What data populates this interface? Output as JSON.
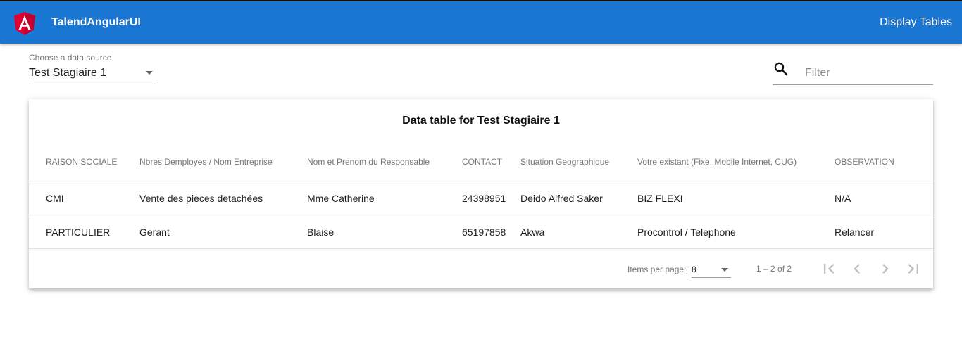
{
  "app": {
    "title": "TalendAngularUI",
    "nav_link": "Display Tables",
    "brand_color": "#1976d2"
  },
  "datasource": {
    "label": "Choose a data source",
    "value": "Test Stagiaire 1"
  },
  "filter": {
    "placeholder": "Filter",
    "value": ""
  },
  "table": {
    "title": "Data table for Test Stagiaire 1",
    "columns": [
      "RAISON SOCIALE",
      "Nbres Demployes / Nom Entreprise",
      "Nom et Prenom du Responsable",
      "CONTACT",
      "Situation Geographique",
      "Votre existant (Fixe, Mobile Internet, CUG)",
      "OBSERVATION"
    ],
    "rows": [
      [
        "CMI",
        "Vente des pieces detachées",
        "Mme Catherine",
        "24398951",
        "Deido Alfred Saker",
        "BIZ FLEXI",
        "N/A"
      ],
      [
        "PARTICULIER",
        "Gerant",
        "Blaise",
        "65197858",
        "Akwa",
        "Procontrol / Telephone",
        "Relancer"
      ]
    ]
  },
  "paginator": {
    "items_per_page_label": "Items per page:",
    "page_size": "8",
    "range_label": "1 – 2 of 2",
    "icons": [
      "first-page-icon",
      "previous-page-icon",
      "next-page-icon",
      "last-page-icon"
    ]
  }
}
